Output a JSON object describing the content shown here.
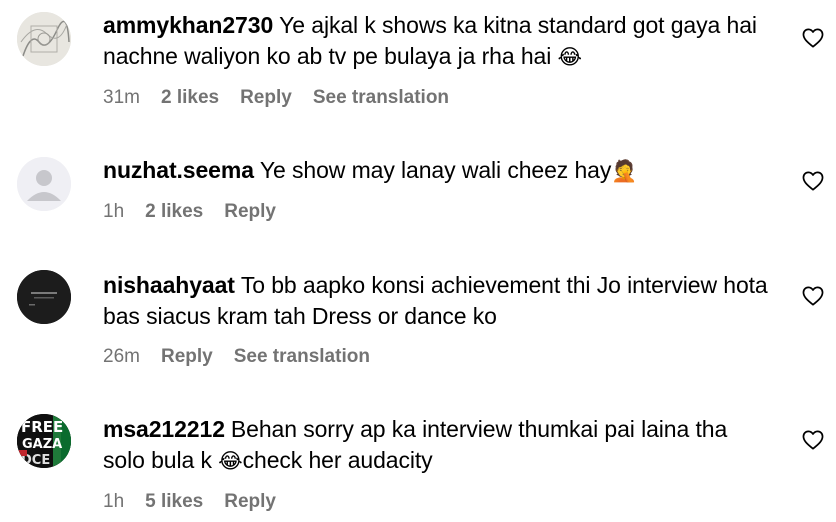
{
  "comments": [
    {
      "username": "ammykhan2730",
      "text": "Ye ajkal k shows ka kitna standard got gaya hai nachne waliyon ko ab tv pe bulaya ja rha hai",
      "emoji_after": "😂",
      "time": "31m",
      "likes": "2 likes",
      "reply": "Reply",
      "translation": "See translation"
    },
    {
      "username": "nuzhat.seema",
      "text": "Ye show may lanay wali cheez hay",
      "emoji_after": "🤦",
      "time": "1h",
      "likes": "2 likes",
      "reply": "Reply"
    },
    {
      "username": "nishaahyaat",
      "text": "To bb aapko konsi achievement thi Jo interview hota bas siacus kram tah Dress or dance ko",
      "time": "26m",
      "reply": "Reply",
      "translation": "See translation"
    },
    {
      "username": "msa212212",
      "text_before_emoji": "Behan sorry ap ka interview thumkai pai laina tha solo bula k",
      "emoji_mid": "😂",
      "text_after_emoji": "check her audacity",
      "time": "1h",
      "likes": "5 likes",
      "reply": "Reply"
    }
  ],
  "avatars": {
    "c4_letters": "FREE GAZA"
  },
  "colors": {
    "meta_text": "#737373",
    "primary_text": "#000000",
    "avatar_default": "#c7c7cc"
  },
  "icons": [
    "heart-outline-icon",
    "default-avatar-icon"
  ]
}
